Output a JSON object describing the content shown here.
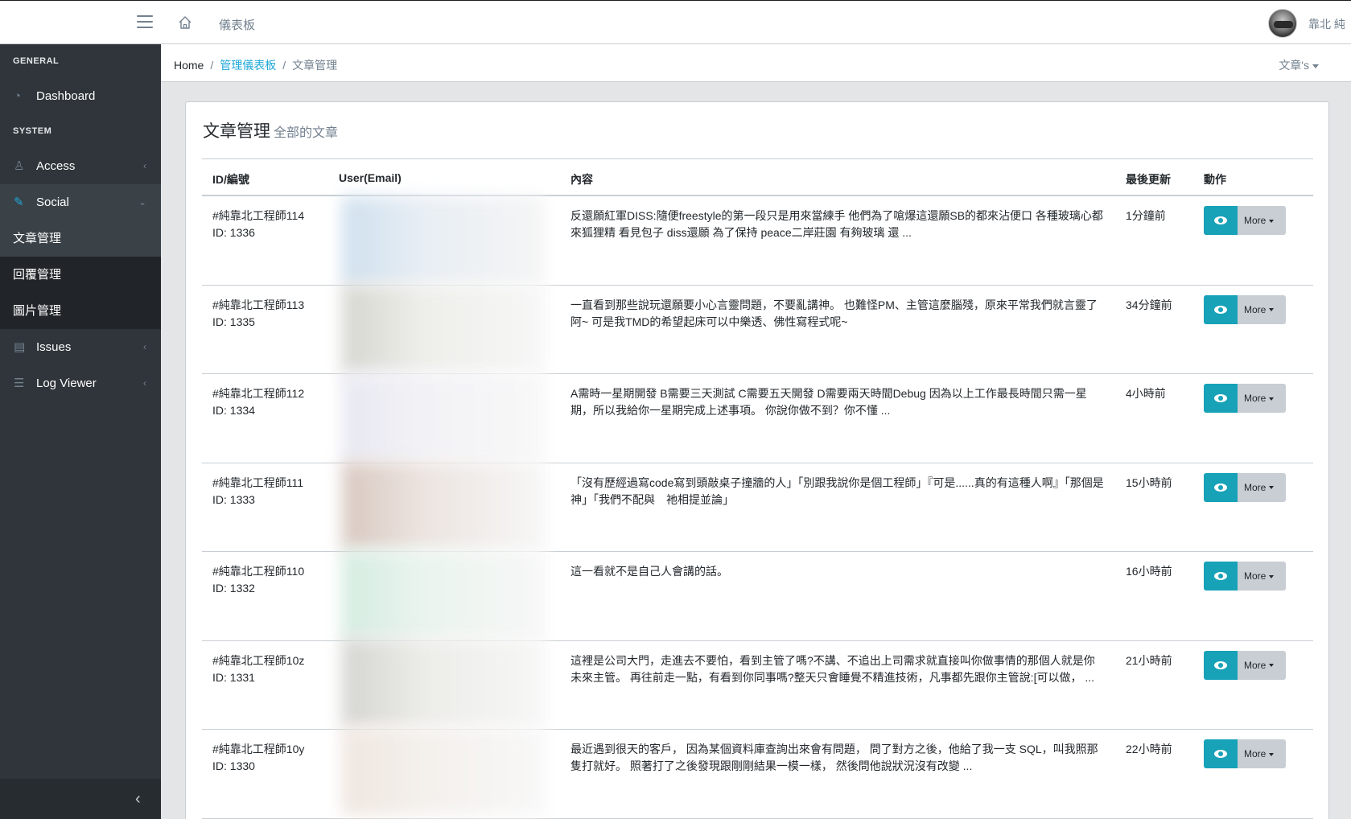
{
  "header": {
    "nav_dashboard": "儀表板",
    "username": "靠北 純"
  },
  "sidebar": {
    "general_title": "GENERAL",
    "system_title": "SYSTEM",
    "items": {
      "dashboard": "Dashboard",
      "access": "Access",
      "social": "Social",
      "articles": "文章管理",
      "replies": "回覆管理",
      "images": "圖片管理",
      "issues": "Issues",
      "log_viewer": "Log Viewer"
    }
  },
  "breadcrumb": {
    "home": "Home",
    "admin_dashboard": "管理儀表板",
    "current": "文章管理",
    "right_menu": "文章's"
  },
  "card": {
    "title": "文章管理",
    "subtitle": "全部的文章"
  },
  "table": {
    "headers": {
      "id": "ID/編號",
      "user": "User(Email)",
      "content": "內容",
      "updated": "最後更新",
      "actions": "動作"
    },
    "more_label": "More",
    "rows": [
      {
        "tag": "#純靠北工程師114",
        "id": "ID: 1336",
        "content": "反還願紅軍DISS:隨便freestyle的第一段只是用來當練手 他們為了嗆爆這還願SB的都來沾便口 各種玻璃心都來狐狸精 看見包子 diss還願 為了保持 peace二岸莊園 有夠玻璃 還 ...",
        "time": "1分鐘前"
      },
      {
        "tag": "#純靠北工程師113",
        "id": "ID: 1335",
        "content": "一直看到那些說玩還願要小心言靈問題，不要亂講神。 也難怪PM、主管這麼腦殘，原來平常我們就言靈了阿~ 可是我TMD的希望起床可以中樂透、佛性寫程式呢~",
        "time": "34分鐘前"
      },
      {
        "tag": "#純靠北工程師112",
        "id": "ID: 1334",
        "content": "A需時一星期開發 B需要三天測試 C需要五天開發 D需要兩天時間Debug 因為以上工作最長時間只需一星期，所以我給你一星期完成上述事項。 你說你做不到？你不懂 ...",
        "time": "4小時前"
      },
      {
        "tag": "#純靠北工程師111",
        "id": "ID: 1333",
        "content": "「沒有歷經過寫code寫到頭敲桌子撞牆的人」「別跟我說你是個工程師」『可是......真的有這種人啊』「那個是神」「我們不配與　祂相提並論」",
        "time": "15小時前"
      },
      {
        "tag": "#純靠北工程師110",
        "id": "ID: 1332",
        "content": "這一看就不是自己人會講的話。",
        "time": "16小時前"
      },
      {
        "tag": "#純靠北工程師10z",
        "id": "ID: 1331",
        "content": "這裡是公司大門，走進去不要怕，看到主管了嗎?不講、不追出上司需求就直接叫你做事情的那個人就是你未來主管。 再往前走一點，有看到你同事嗎?整天只會睡覺不精進技術，凡事都先跟你主管說:[可以做， ...",
        "time": "21小時前"
      },
      {
        "tag": "#純靠北工程師10y",
        "id": "ID: 1330",
        "content": "最近遇到很天的客戶， 因為某個資料庫查詢出來會有問題， 問了對方之後，他給了我一支 SQL，叫我照那隻打就好。 照著打了之後發現跟剛剛結果一模一樣， 然後問他說狀況沒有改變 ...",
        "time": "22小時前"
      }
    ]
  },
  "colors": {
    "sidebar_bg": "#2f353a",
    "accent": "#20a8d8",
    "view_button": "#17a2b8"
  }
}
